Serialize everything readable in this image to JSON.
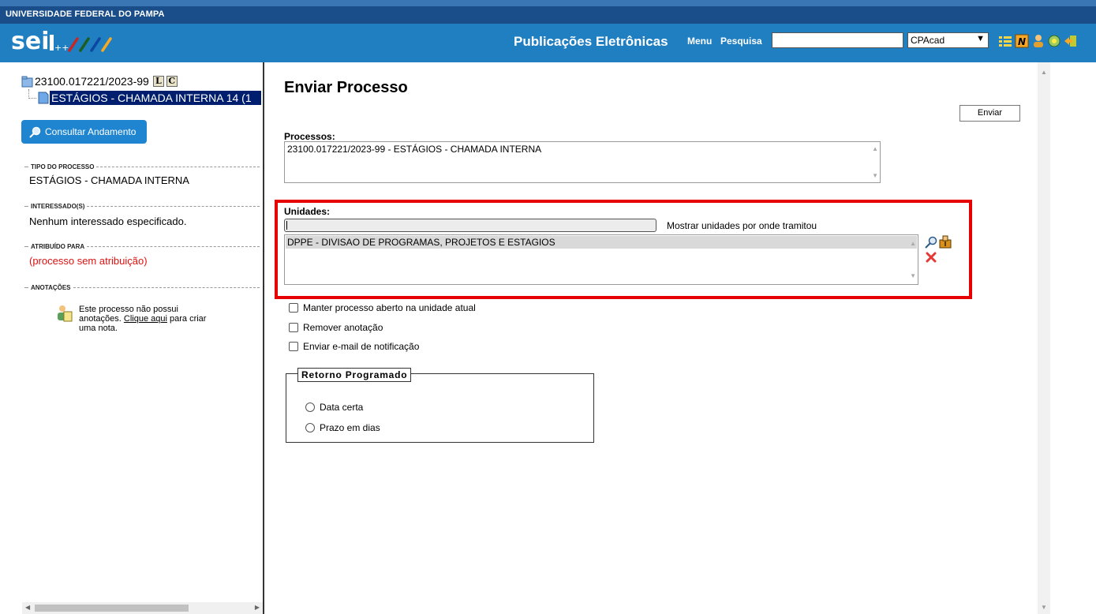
{
  "header": {
    "org_name": "UNIVERSIDADE FEDERAL DO PAMPA",
    "logo_text": "sei",
    "logo_suffix": "++",
    "title": "Publicações Eletrônicas",
    "menu_label": "Menu",
    "search_label": "Pesquisa",
    "search_value": "",
    "unit_selected": "CPAcad",
    "icons": [
      "list-icon",
      "notice-icon",
      "user-icon",
      "settings-icon",
      "exit-icon"
    ],
    "accent": "#1f7fc1",
    "org_bar_color": "#1a4e8a"
  },
  "tree": {
    "process_number": "23100.017221/2023-99",
    "badge_l": "L",
    "badge_c": "C",
    "document_label": "ESTÁGIOS - CHAMADA INTERNA 14 (1"
  },
  "sidebar": {
    "consult_button": "Consultar Andamento",
    "tipo_label": "TIPO DO PROCESSO",
    "tipo_value": "ESTÁGIOS - CHAMADA INTERNA",
    "interessados_label": "INTERESSADO(S)",
    "interessados_value": "Nenhum interessado especificado.",
    "atribuido_label": "ATRIBUÍDO PARA",
    "atribuido_value": "(processo sem atribuição)",
    "anotacoes_label": "ANOTAÇÕES",
    "notes_text_1": "Este processo não possui",
    "notes_text_2_prefix": "anotações.",
    "notes_link": "Clique aqui",
    "notes_text_2_suffix": "para criar",
    "notes_text_3": "uma nota."
  },
  "main": {
    "title": "Enviar Processo",
    "send_button": "Enviar",
    "processos_label": "Processos:",
    "processos_value": "23100.017221/2023-99 - ESTÁGIOS - CHAMADA INTERNA",
    "unidades_label": "Unidades:",
    "unidades_input": "",
    "show_units_label": "Mostrar unidades por onde tramitou",
    "unidades_list": [
      "DPPE - DIVISAO DE PROGRAMAS, PROJETOS E ESTAGIOS"
    ],
    "checkboxes": [
      {
        "label": "Manter processo aberto na unidade atual",
        "checked": false
      },
      {
        "label": "Remover anotação",
        "checked": false
      },
      {
        "label": "Enviar e-mail de notificação",
        "checked": false
      }
    ],
    "retorno_legend": "Retorno Programado",
    "radios": [
      {
        "label": "Data certa",
        "checked": false
      },
      {
        "label": "Prazo em dias",
        "checked": false
      }
    ],
    "highlight_color": "#e60000"
  }
}
